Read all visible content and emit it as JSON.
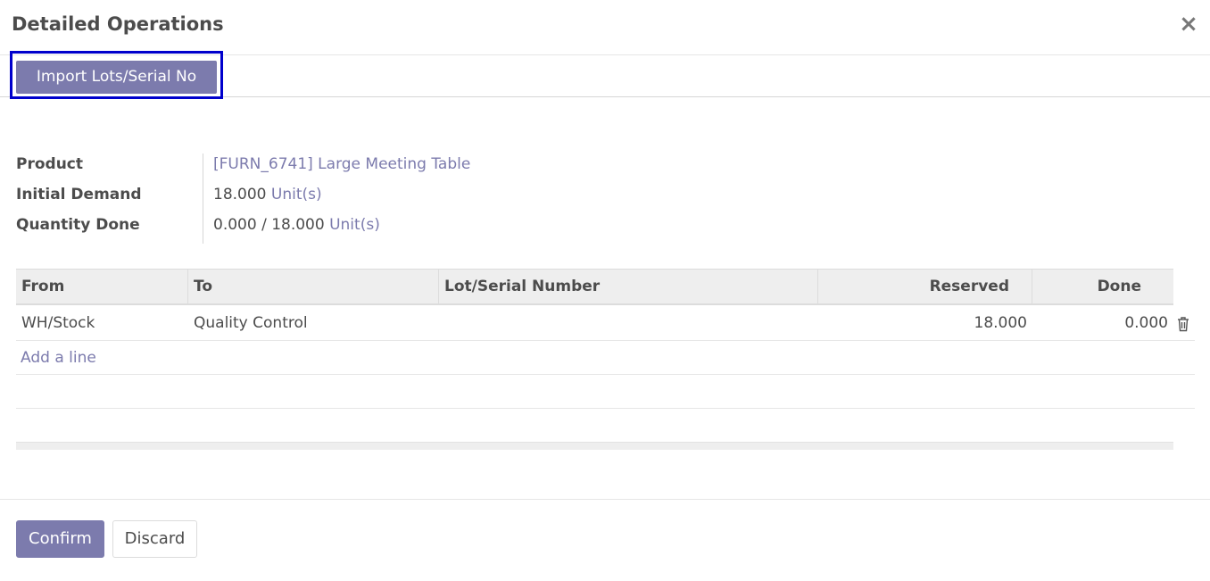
{
  "dialog": {
    "title": "Detailed Operations",
    "close_icon": "close-icon"
  },
  "toolbar": {
    "import_label": "Import Lots/Serial No"
  },
  "form": {
    "product_label": "Product",
    "product_value": "[FURN_6741] Large Meeting Table",
    "initial_demand_label": "Initial Demand",
    "initial_demand_qty": "18.000",
    "initial_demand_uom": "Unit(s)",
    "quantity_done_label": "Quantity Done",
    "quantity_done_qty": "0.000 / 18.000",
    "quantity_done_uom": "Unit(s)"
  },
  "table": {
    "columns": [
      "From",
      "To",
      "Lot/Serial Number",
      "Reserved",
      "Done"
    ],
    "rows": [
      {
        "from": "WH/Stock",
        "to": "Quality Control",
        "lot": "",
        "reserved": "18.000",
        "done": "0.000",
        "delete_icon": "trash-icon"
      }
    ],
    "add_line_label": "Add a line"
  },
  "footer": {
    "confirm_label": "Confirm",
    "discard_label": "Discard"
  },
  "colors": {
    "accent": "#7c7bad",
    "highlight_border": "#0000cc",
    "text": "#4c4c4c",
    "header_bg": "#eeeeee"
  }
}
